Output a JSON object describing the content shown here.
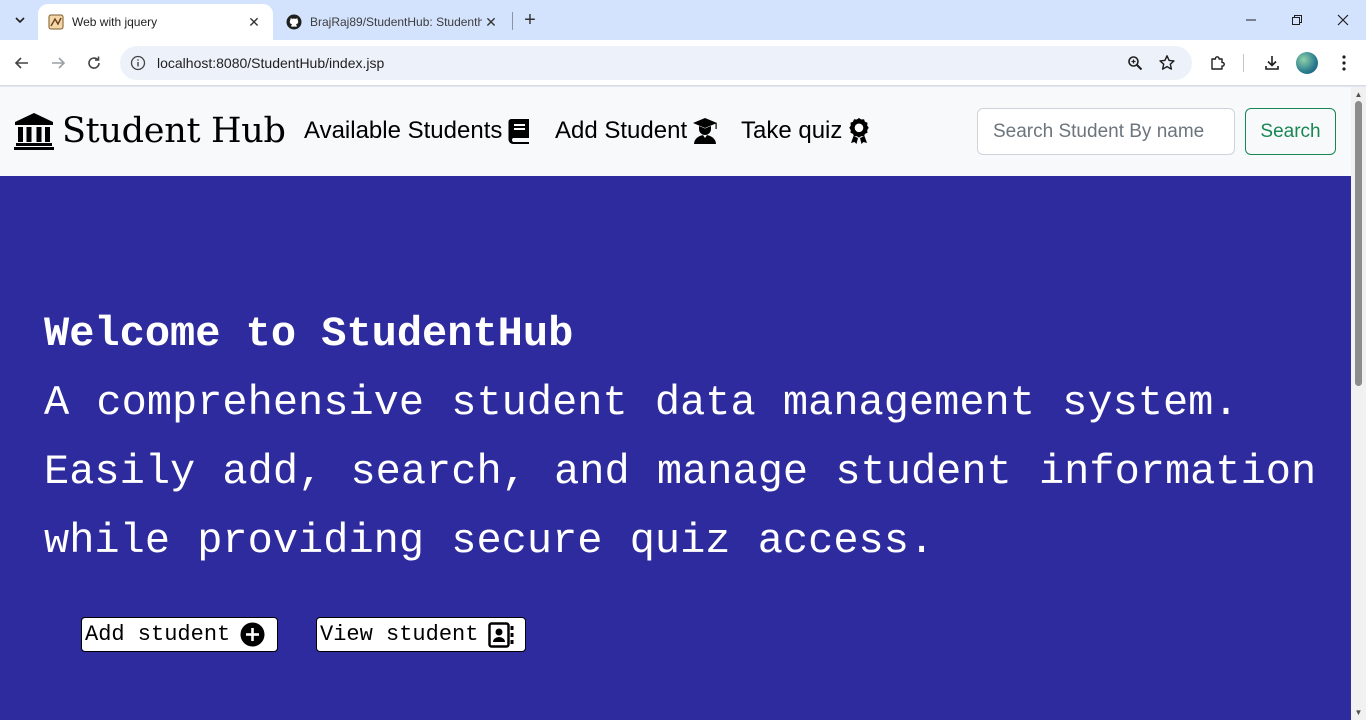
{
  "browser": {
    "tabs": [
      {
        "title": "Web with jquery",
        "active": true
      },
      {
        "title": "BrajRaj89/StudentHub: Studenth",
        "active": false
      }
    ],
    "address": "localhost:8080/StudentHub/index.jsp"
  },
  "navbar": {
    "brand": "Student Hub",
    "links": [
      {
        "label": "Available Students",
        "icon": "book-icon"
      },
      {
        "label": "Add Student",
        "icon": "graduate-icon"
      },
      {
        "label": "Take quiz",
        "icon": "award-icon"
      }
    ],
    "search": {
      "placeholder": "Search Student By name",
      "value": ""
    },
    "search_button": "Search"
  },
  "hero": {
    "title": "Welcome to StudentHub",
    "description": "A comprehensive student data management system. Easily add, search, and manage student information while providing secure quiz access.",
    "buttons": [
      {
        "label": "Add student",
        "icon": "plus-circle-icon"
      },
      {
        "label": "View student",
        "icon": "contact-book-icon"
      }
    ]
  },
  "colors": {
    "hero_bg": "#2e2b9e",
    "navbar_bg": "#f8f9fa",
    "search_btn": "#198754",
    "tabstrip_bg": "#d3e3fd"
  }
}
